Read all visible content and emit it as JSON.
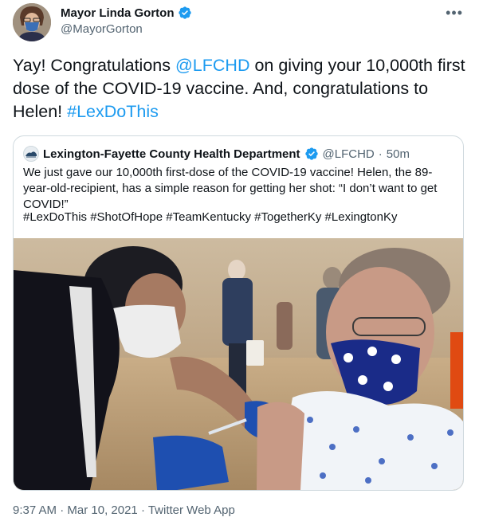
{
  "author": {
    "name": "Mayor Linda Gorton",
    "handle": "@MayorGorton"
  },
  "tweet": {
    "text_before": "Yay! Congratulations ",
    "mention": "@LFCHD",
    "text_middle": " on giving your 10,000th first dose of the COVID-19 vaccine. And, congratulations to Helen! ",
    "hashtag": "#LexDoThis"
  },
  "quoted": {
    "name": "Lexington-Fayette County Health Department",
    "handle": "@LFCHD",
    "separator": "·",
    "time": "50m",
    "text": "We just gave our 10,000th first-dose of the COVID-19 vaccine! Helen, the 89-year-old-recipient, has a simple reason for getting her shot: “I don’t want to get COVID!”",
    "hashtags": "#LexDoThis #ShotOfHope #TeamKentucky #TogetherKy #LexingtonKy"
  },
  "footer": {
    "time": "9:37 AM",
    "date": "Mar 10, 2021",
    "source": "Twitter Web App",
    "separator": " · "
  },
  "colors": {
    "link": "#1d9bf0",
    "secondary_text": "#536471",
    "verified": "#1d9bf0"
  },
  "icons": [
    "verified-badge-icon",
    "more-options-icon"
  ]
}
